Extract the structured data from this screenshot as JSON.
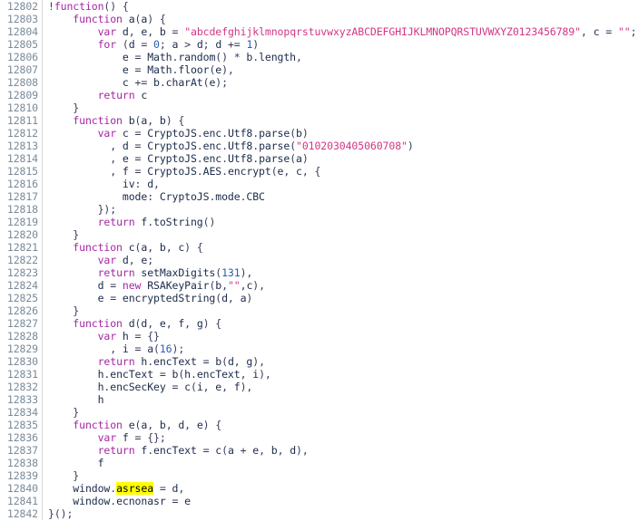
{
  "editor": {
    "language": "javascript",
    "first_line_number": 12802,
    "last_line_number": 12842,
    "total_visible_lines": 41,
    "background_color": "#ffffff",
    "gutter_color": "#7a8a99",
    "keyword_color": "#a626a4",
    "string_color": "#d33682",
    "number_color": "#2a5db0",
    "identifier_color": "#1a2a4a",
    "highlight_background": "#ffff00",
    "highlight_text": "asrsea"
  },
  "lines": [
    {
      "n": "12802",
      "text": "!function() {"
    },
    {
      "n": "12803",
      "text": "    function a(a) {"
    },
    {
      "n": "12804",
      "text": "        var d, e, b = \"abcdefghijklmnopqrstuvwxyzABCDEFGHIJKLMNOPQRSTUVWXYZ0123456789\", c = \"\";"
    },
    {
      "n": "12805",
      "text": "        for (d = 0; a > d; d += 1)"
    },
    {
      "n": "12806",
      "text": "            e = Math.random() * b.length,"
    },
    {
      "n": "12807",
      "text": "            e = Math.floor(e),"
    },
    {
      "n": "12808",
      "text": "            c += b.charAt(e);"
    },
    {
      "n": "12809",
      "text": "        return c"
    },
    {
      "n": "12810",
      "text": "    }"
    },
    {
      "n": "12811",
      "text": "    function b(a, b) {"
    },
    {
      "n": "12812",
      "text": "        var c = CryptoJS.enc.Utf8.parse(b)"
    },
    {
      "n": "12813",
      "text": "          , d = CryptoJS.enc.Utf8.parse(\"0102030405060708\")"
    },
    {
      "n": "12814",
      "text": "          , e = CryptoJS.enc.Utf8.parse(a)"
    },
    {
      "n": "12815",
      "text": "          , f = CryptoJS.AES.encrypt(e, c, {"
    },
    {
      "n": "12816",
      "text": "            iv: d,"
    },
    {
      "n": "12817",
      "text": "            mode: CryptoJS.mode.CBC"
    },
    {
      "n": "12818",
      "text": "        });"
    },
    {
      "n": "12819",
      "text": "        return f.toString()"
    },
    {
      "n": "12820",
      "text": "    }"
    },
    {
      "n": "12821",
      "text": "    function c(a, b, c) {"
    },
    {
      "n": "12822",
      "text": "        var d, e;"
    },
    {
      "n": "12823",
      "text": "        return setMaxDigits(131),"
    },
    {
      "n": "12824",
      "text": "        d = new RSAKeyPair(b,\"\",c),"
    },
    {
      "n": "12825",
      "text": "        e = encryptedString(d, a)"
    },
    {
      "n": "12826",
      "text": "    }"
    },
    {
      "n": "12827",
      "text": "    function d(d, e, f, g) {"
    },
    {
      "n": "12828",
      "text": "        var h = {}"
    },
    {
      "n": "12829",
      "text": "          , i = a(16);"
    },
    {
      "n": "12830",
      "text": "        return h.encText = b(d, g),"
    },
    {
      "n": "12831",
      "text": "        h.encText = b(h.encText, i),"
    },
    {
      "n": "12832",
      "text": "        h.encSecKey = c(i, e, f),"
    },
    {
      "n": "12833",
      "text": "        h"
    },
    {
      "n": "12834",
      "text": "    }"
    },
    {
      "n": "12835",
      "text": "    function e(a, b, d, e) {"
    },
    {
      "n": "12836",
      "text": "        var f = {};"
    },
    {
      "n": "12837",
      "text": "        return f.encText = c(a + e, b, d),"
    },
    {
      "n": "12838",
      "text": "        f"
    },
    {
      "n": "12839",
      "text": "    }"
    },
    {
      "n": "12840",
      "text": "    window.asrsea = d,"
    },
    {
      "n": "12841",
      "text": "    window.ecnonasr = e"
    },
    {
      "n": "12842",
      "text": "}();"
    }
  ],
  "tokens": {
    "keywords": [
      "function",
      "var",
      "for",
      "return",
      "new"
    ],
    "strings": [
      "\"abcdefghijklmnopqrstuvwxyzABCDEFGHIJKLMNOPQRSTUVWXYZ0123456789\"",
      "\"\"",
      "\"0102030405060708\""
    ],
    "numbers": [
      "0",
      "1",
      "131",
      "16"
    ]
  }
}
